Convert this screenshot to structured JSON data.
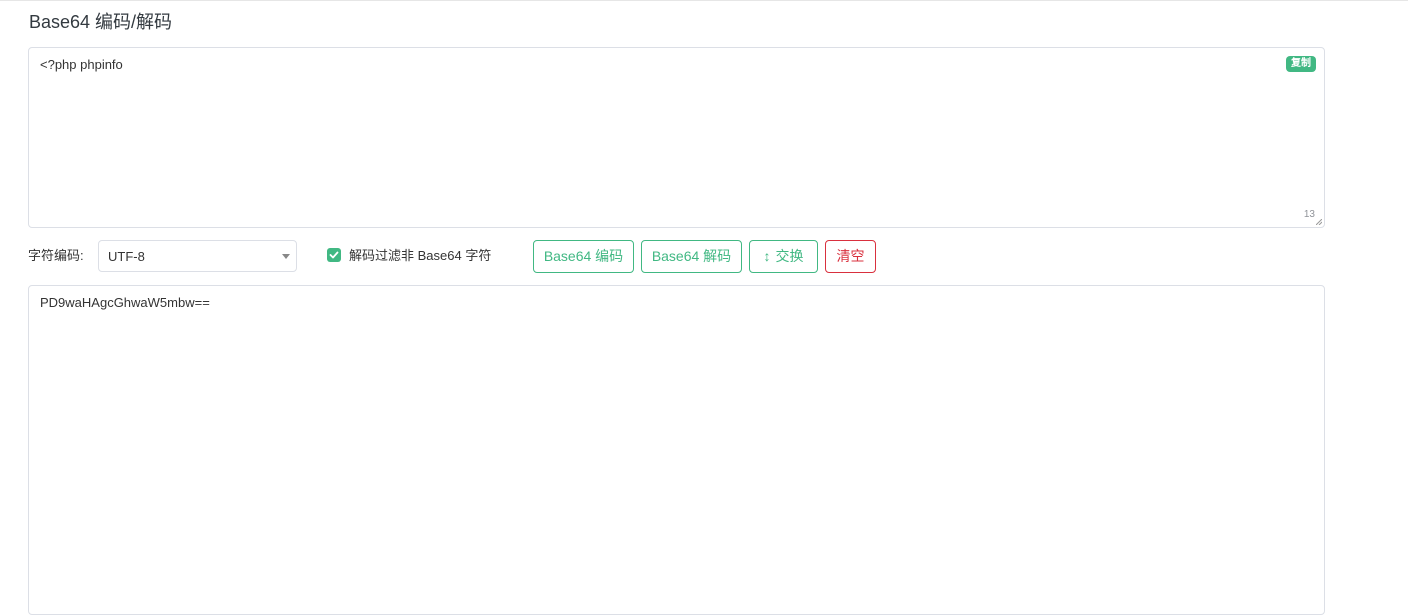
{
  "page": {
    "title": "Base64 编码/解码"
  },
  "input": {
    "value": "<?php phpinfo",
    "copy_label": "复制",
    "char_count": "13"
  },
  "toolbar": {
    "charset_label": "字符编码:",
    "charset_value": "UTF-8",
    "filter_checked": true,
    "filter_label": "解码过滤非 Base64 字符",
    "encode_label": "Base64 编码",
    "decode_label": "Base64 解码",
    "swap_icon": "↕",
    "swap_label": "交换",
    "clear_label": "清空"
  },
  "output": {
    "value": "PD9waHAgcGhwaW5mbw=="
  },
  "colors": {
    "accent": "#41b883",
    "danger": "#d9303e",
    "border": "#dcdfe6"
  }
}
